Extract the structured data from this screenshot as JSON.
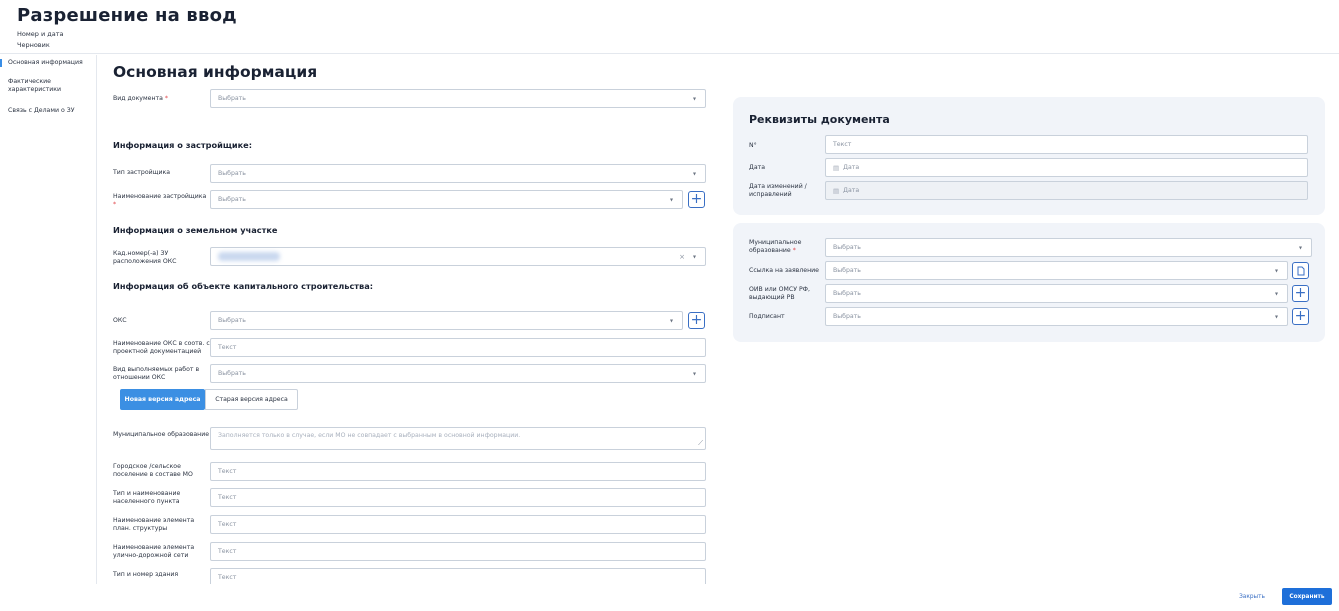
{
  "header": {
    "title": "Разрешение на ввод",
    "number_date": "Номер и дата",
    "status": "Черновик"
  },
  "sidebar": {
    "items": [
      {
        "label": "Основная информация",
        "active": true
      },
      {
        "label": "Фактические характеристики",
        "active": false
      },
      {
        "label": "Связь с Делами о ЗУ",
        "active": false
      }
    ]
  },
  "main": {
    "title": "Основная информация",
    "doc_type": {
      "label": "Вид документа",
      "required_mark": "*",
      "placeholder": "Выбрать"
    },
    "developer_section": {
      "title": "Информация о застройщике:",
      "type": {
        "label": "Тип застройщика",
        "placeholder": "Выбрать"
      },
      "name": {
        "label": "Наименование застройщика",
        "required_mark": "*",
        "placeholder": "Выбрать"
      }
    },
    "land_section": {
      "title": "Информация о земельном участке",
      "cadastral": {
        "label": "Кад.номер(-а) ЗУ расположения ОКС",
        "clear": "×",
        "value_redacted": true
      }
    },
    "oks_section": {
      "title": "Информация об объекте капитального строительства:",
      "oks": {
        "label": "ОКС",
        "placeholder": "Выбрать"
      },
      "oks_name": {
        "label": "Наименование ОКС в соотв. с проектной документацией",
        "placeholder": "Текст"
      },
      "work_type": {
        "label": "Вид выполняемых работ в отношении ОКС",
        "placeholder": "Выбрать"
      }
    },
    "address_toggle": {
      "new": "Новая версия адреса",
      "old": "Старая версия адреса"
    },
    "address": {
      "municipality": {
        "label": "Муниципальное образование",
        "placeholder": "Заполняется только в случае, если МО не совпадает с выбранным в основной информации."
      },
      "settlement": {
        "label": "Городское /сельское поселение в составе МО",
        "placeholder": "Текст"
      },
      "locality": {
        "label": "Тип и наименование населенного пункта",
        "placeholder": "Текст"
      },
      "plan_element": {
        "label": "Наименование элемента план. структуры",
        "placeholder": "Текст"
      },
      "street": {
        "label": "Наименование элемента улично-дорожной сети",
        "placeholder": "Текст"
      },
      "building": {
        "label": "Тип и номер здания",
        "placeholder": "Текст"
      }
    }
  },
  "details": {
    "title": "Реквизиты документа",
    "number": {
      "label": "N°",
      "placeholder": "Текст"
    },
    "date": {
      "label": "Дата",
      "placeholder": "Дата"
    },
    "change_date": {
      "label": "Дата изменений / исправлений",
      "placeholder": "Дата"
    }
  },
  "extra": {
    "municipality": {
      "label": "Муниципальное образование",
      "required_mark": "*",
      "placeholder": "Выбрать"
    },
    "application_link": {
      "label": "Ссылка на заявление",
      "placeholder": "Выбрать"
    },
    "authority": {
      "label": "ОИВ или ОМСУ РФ, выдающий РВ",
      "placeholder": "Выбрать"
    },
    "signer": {
      "label": "Подписант",
      "placeholder": "Выбрать"
    }
  },
  "footer": {
    "close": "Закрыть",
    "save": "Сохранить"
  },
  "icons": {
    "dropdown": "▾",
    "plus": "+",
    "calendar": "▤",
    "resize": "⟋"
  },
  "colors": {
    "accent": "#3b8fe3",
    "primary_button": "#1e6fd9",
    "required": "#e0464b",
    "card_bg": "#f1f4f9"
  }
}
